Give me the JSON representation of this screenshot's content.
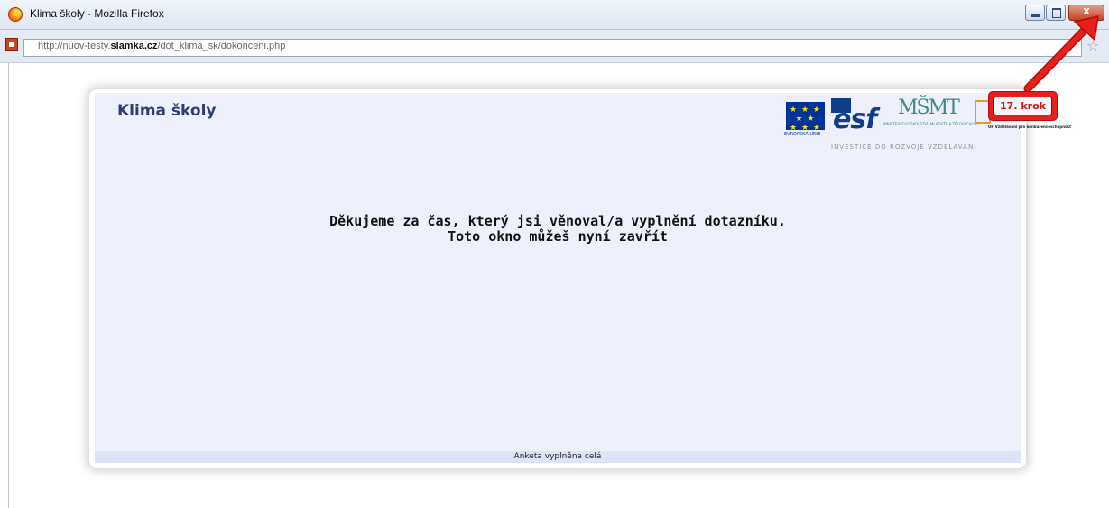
{
  "window": {
    "title": "Klima školy - Mozilla Firefox",
    "controls": {
      "minimize": "minimize",
      "maximize": "maximize",
      "close": "x"
    }
  },
  "addressbar": {
    "url_prefix": "http://nuov-testy.",
    "url_domain": "slamka.cz",
    "url_path": "/dot_klima_sk/dokonceni.php",
    "bookmark_icon": "star-icon"
  },
  "page": {
    "title": "Klima školy",
    "logos": {
      "eu_caption": "EVROPSKÁ UNIE",
      "esf_text": "esf",
      "msmt_caption": "MINISTERSTVO ŠKOLSTVÍ, MLÁDEŽE A TĚLOVÝCHOVY",
      "op_caption": "OP Vzdělávání pro konkurenceschopnost",
      "tagline": "INVESTICE DO ROZVOJE VZDĚLÁVÁNÍ"
    },
    "message_line1": "Děkujeme za čas, který jsi věnoval/a vyplnění dotazníku.",
    "message_line2": "Toto okno můžeš nyní zavřít",
    "footer": "Anketa vyplněna celá"
  },
  "annotation": {
    "label": "17. krok",
    "color": "#e8201c"
  }
}
